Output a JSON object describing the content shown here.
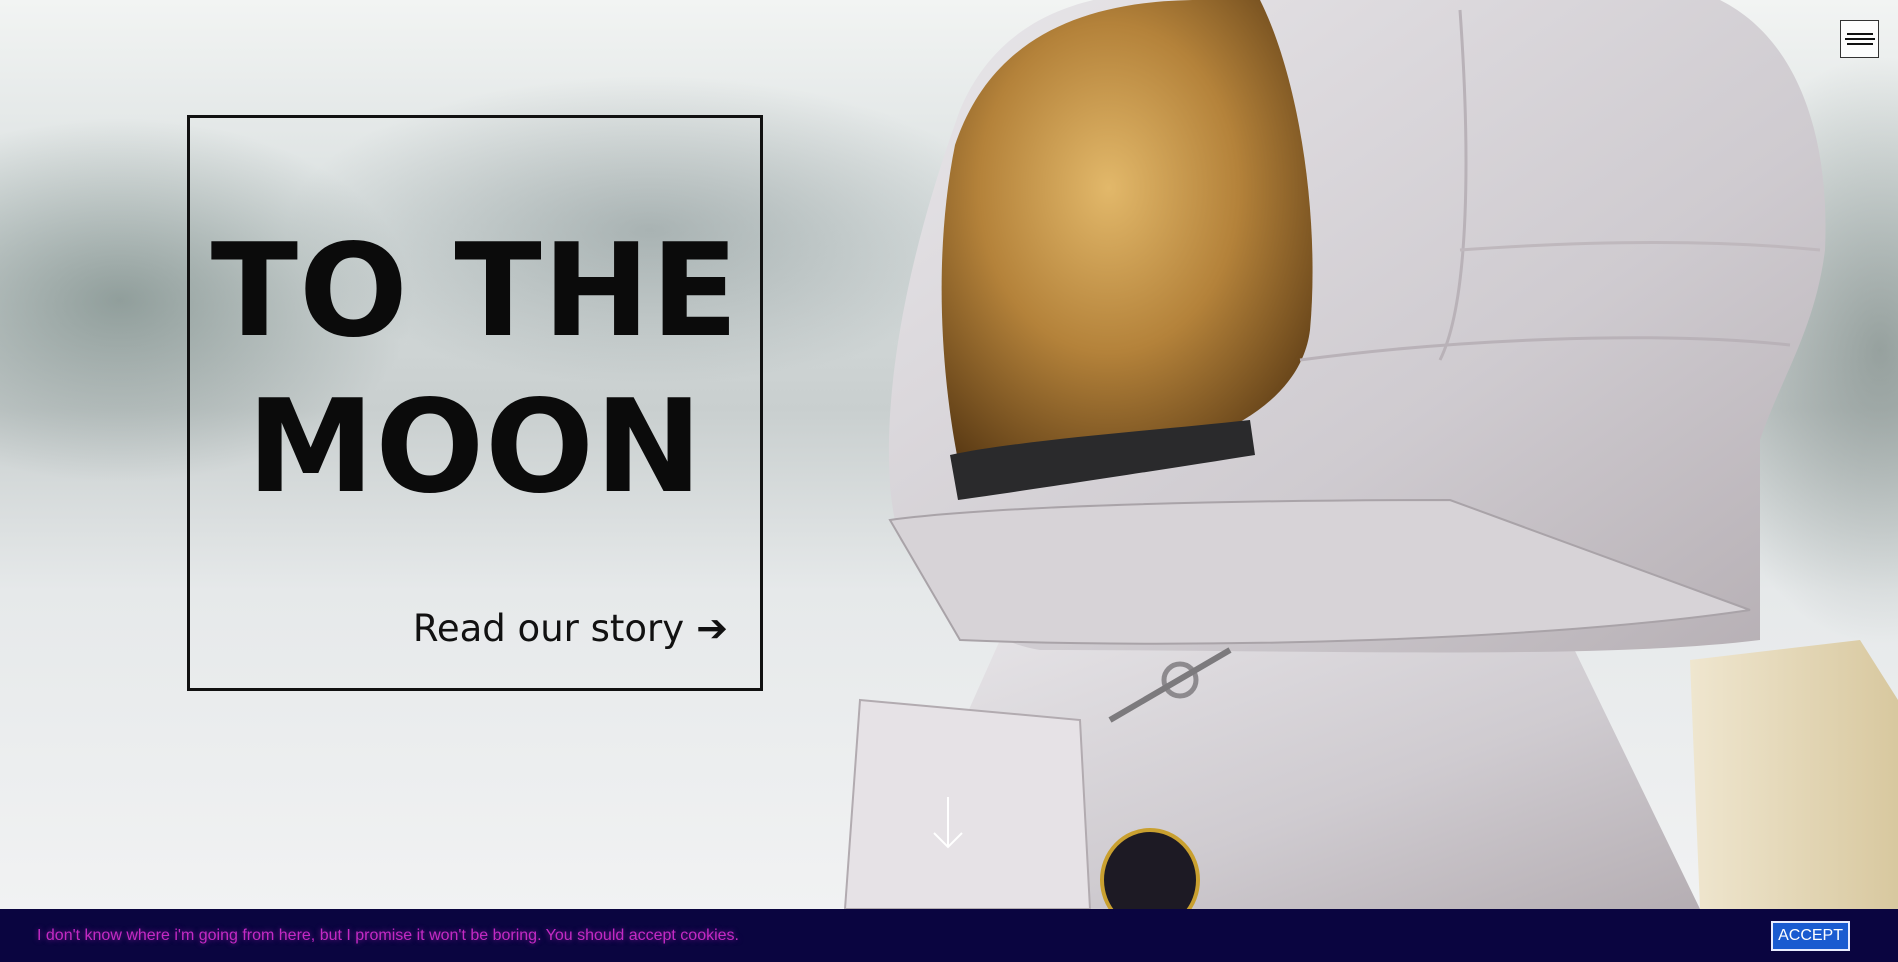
{
  "menu": {
    "icon": "hamburger-menu-icon"
  },
  "hero": {
    "title_line1": "TO THE",
    "title_line2": "MOON",
    "story_link_label": "Read our story",
    "story_link_arrow": "➔",
    "scroll_icon": "arrow-down-icon"
  },
  "cookie": {
    "message": "I don't know where i'm going from here, but I promise it won't be boring. You should accept cookies.",
    "accept_label": "ACCEPT"
  },
  "colors": {
    "cookie_bg": "#0a0540",
    "cookie_text": "#c42ac4",
    "accept_bg": "#1a5bd0",
    "title_text": "#0b0b0b"
  }
}
